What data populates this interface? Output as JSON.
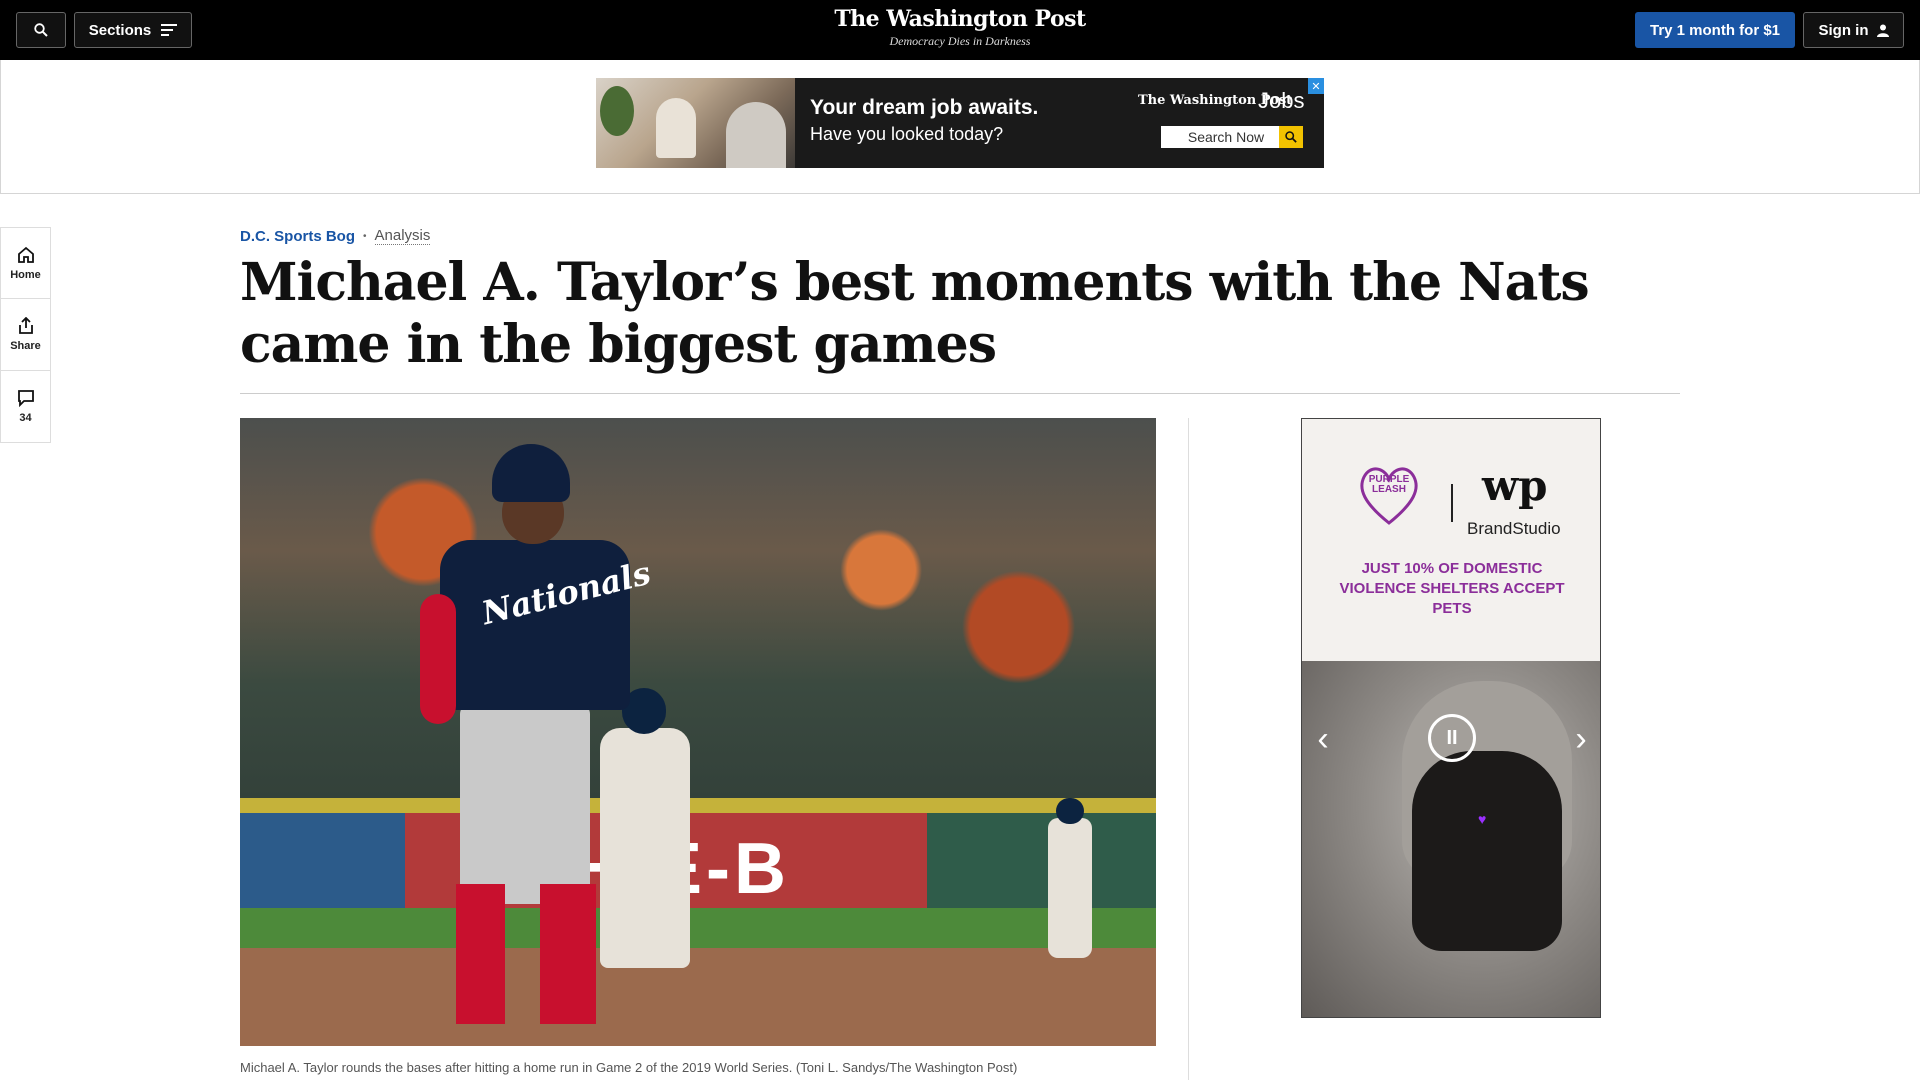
{
  "nav": {
    "sections_label": "Sections",
    "logo_name": "The Washington Post",
    "logo_tagline": "Democracy Dies in Darkness",
    "try_label": "Try 1 month for $1",
    "signin_label": "Sign in"
  },
  "top_ad": {
    "headline": "Your dream job awaits.",
    "subline": "Have you looked today?",
    "brand": "The Washington Post",
    "brand_suffix": "Jobs",
    "search_label": "Search Now",
    "close_glyph": "✕"
  },
  "rail": {
    "items": [
      {
        "label": "Home",
        "icon": "home-icon"
      },
      {
        "label": "Share",
        "icon": "share-icon"
      },
      {
        "label": "34",
        "icon": "comment-icon"
      }
    ]
  },
  "article": {
    "section": "D.C. Sports Bog",
    "separator": "•",
    "label": "Analysis",
    "headline": "Michael A. Taylor’s best moments with the Nats came in the biggest games",
    "photo_caption": "Michael A. Taylor rounds the bases after hitting a home run in Game 2 of the 2019 World Series. (Toni L. Sandys/The Washington Post)",
    "photo_banner_text": "H-E-B",
    "jersey_text": "Nationals"
  },
  "side_ad": {
    "logo_text": "PURPLE LEASH",
    "wp_mark": "wp",
    "brand_studio": "BrandStudio",
    "copy": "JUST 10% OF DOMESTIC VIOLENCE SHELTERS ACCEPT PETS",
    "prev_glyph": "‹",
    "next_glyph": "›",
    "pause_glyph": "II"
  },
  "colors": {
    "brand_blue": "#1955a5",
    "ad_purple": "#8b2e9a"
  }
}
